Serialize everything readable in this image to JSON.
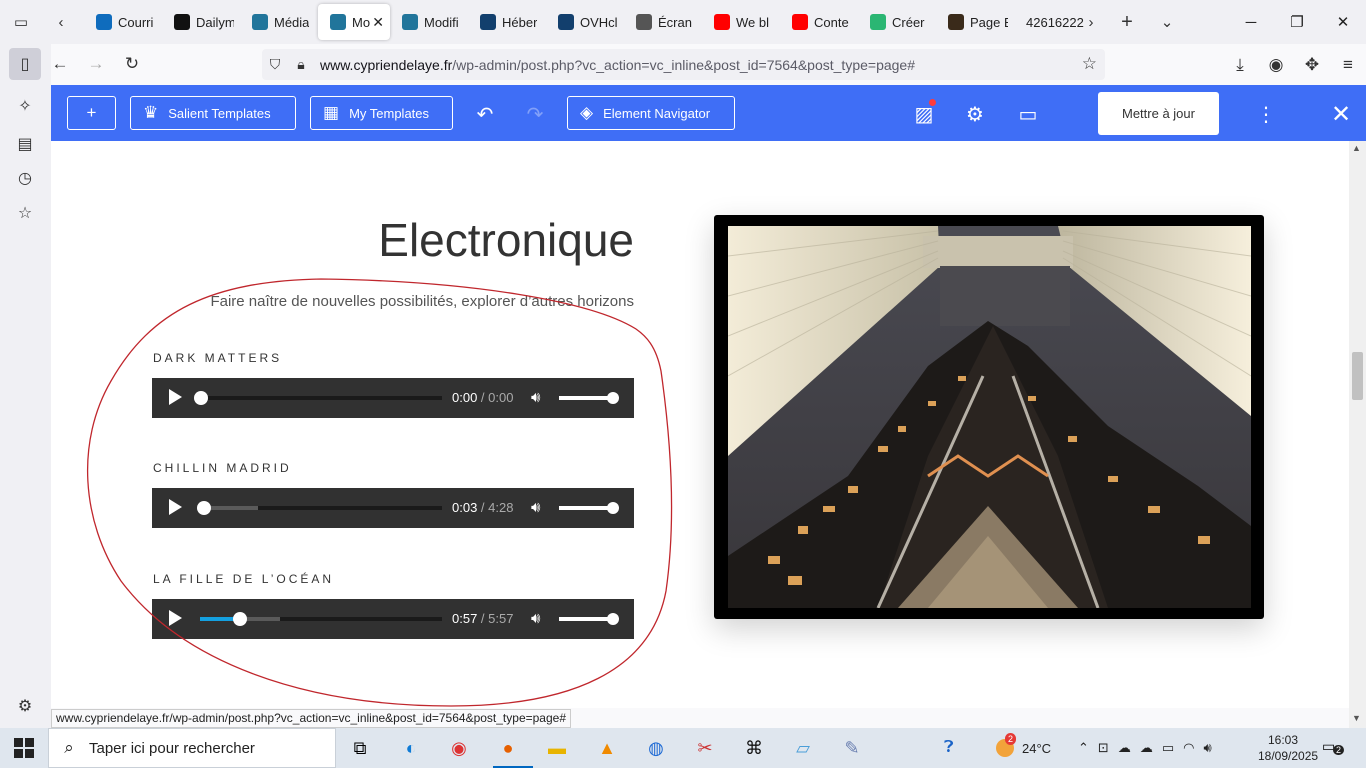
{
  "browser": {
    "tabs": [
      {
        "label": "Courri",
        "icon": "outlook-icon",
        "color": "#0f6cbd",
        "active": false
      },
      {
        "label": "Dailym",
        "icon": "dailymotion-icon",
        "color": "#111111",
        "active": false
      },
      {
        "label": "Média",
        "icon": "wordpress-icon",
        "color": "#21759b",
        "active": false
      },
      {
        "label": "Mo",
        "icon": "wordpress-icon",
        "color": "#21759b",
        "active": true
      },
      {
        "label": "Modifi",
        "icon": "wordpress-icon",
        "color": "#21759b",
        "active": false
      },
      {
        "label": "Héber",
        "icon": "ovh-icon",
        "color": "#123f6d",
        "active": false
      },
      {
        "label": "OVHcl",
        "icon": "ovh-icon",
        "color": "#123f6d",
        "active": false
      },
      {
        "label": "Écran",
        "icon": "wordpress-icon",
        "color": "#555555",
        "active": false
      },
      {
        "label": "We bl",
        "icon": "youtube-icon",
        "color": "#ff0000",
        "active": false
      },
      {
        "label": "Conte",
        "icon": "youtube-icon",
        "color": "#ff0000",
        "active": false
      },
      {
        "label": "Créer",
        "icon": "feather-icon",
        "color": "#2bb673",
        "active": false
      },
      {
        "label": "Page E",
        "icon": "page-icon",
        "color": "#3a2a1a",
        "active": false
      },
      {
        "label": "42616222",
        "icon": "",
        "color": "",
        "active": false
      }
    ],
    "url_domain": "www.cypriendelaye.fr",
    "url_path": "/wp-admin/post.php?vc_action=vc_inline&post_id=7564&post_type=page#",
    "status_url": "www.cypriendelaye.fr/wp-admin/post.php?vc_action=vc_inline&post_id=7564&post_type=page#"
  },
  "toolbar": {
    "salient_templates": "Salient Templates",
    "my_templates": "My Templates",
    "element_navigator": "Element Navigator",
    "update": "Mettre à jour",
    "accent": "#3f6ef6"
  },
  "section": {
    "title": "Electronique",
    "subtitle": "Faire naître de nouvelles possibilités, explorer d’autres horizons"
  },
  "tracks": [
    {
      "title": "DARK MATTERS",
      "current": "0:00",
      "duration": "0:00",
      "played_fraction": 0.0,
      "buffered_fraction": 0.0
    },
    {
      "title": "CHILLIN MADRID",
      "current": "0:03",
      "duration": "4:28",
      "played_fraction": 0.012,
      "buffered_fraction": 0.24
    },
    {
      "title": "LA FILLE DE L’OCÉAN",
      "current": "0:57",
      "duration": "5:57",
      "played_fraction": 0.16,
      "buffered_fraction": 0.33
    }
  ],
  "taskbar": {
    "search_placeholder": "Taper ici pour rechercher",
    "weather": "24°C",
    "weather_badge": "2",
    "time": "16:03",
    "date": "18/09/2025",
    "notifications": "2"
  }
}
